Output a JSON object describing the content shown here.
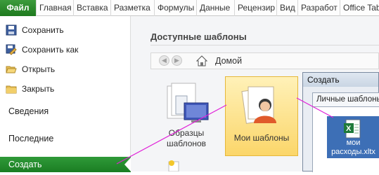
{
  "ribbon": {
    "tabs": [
      "Файл",
      "Главная",
      "Вставка",
      "Разметка",
      "Формулы",
      "Данные",
      "Рецензир",
      "Вид",
      "Разработ",
      "Office Tab"
    ]
  },
  "sidebar": {
    "commands": [
      {
        "label": "Сохранить",
        "icon": "save-icon"
      },
      {
        "label": "Сохранить как",
        "icon": "save-as-icon"
      },
      {
        "label": "Открыть",
        "icon": "open-folder-icon"
      },
      {
        "label": "Закрыть",
        "icon": "close-folder-icon"
      }
    ],
    "sections": [
      "Сведения",
      "Последние"
    ],
    "active": "Создать"
  },
  "main": {
    "title": "Доступные шаблоны",
    "breadcrumb": "Домой",
    "templates": [
      {
        "label": "Образцы шаблонов",
        "icon": "sample-templates-icon"
      },
      {
        "label": "Мои шаблоны",
        "icon": "my-templates-icon",
        "selected": true
      }
    ]
  },
  "dialog": {
    "title": "Создать",
    "tab": "Личные шаблоны",
    "file": {
      "name": "мои расходы.xltx",
      "icon": "excel-template-icon"
    }
  },
  "colors": {
    "accent": "#1e7a1e",
    "selection": "#fbd66a",
    "annotation": "#e01fd8"
  }
}
